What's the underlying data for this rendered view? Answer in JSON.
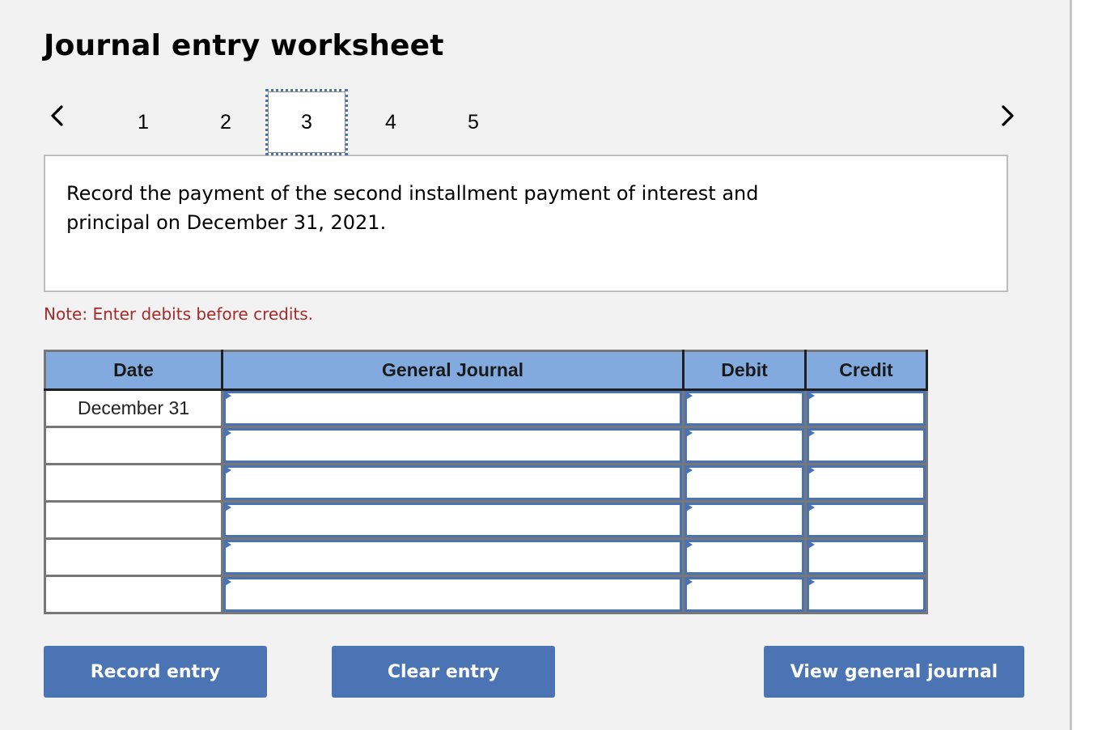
{
  "header": {
    "title": "Journal entry worksheet"
  },
  "pager": {
    "prev_icon": "chevron-left-icon",
    "next_icon": "chevron-right-icon",
    "tabs": [
      {
        "label": "1",
        "active": false
      },
      {
        "label": "2",
        "active": false
      },
      {
        "label": "3",
        "active": true
      },
      {
        "label": "4",
        "active": false
      },
      {
        "label": "5",
        "active": false
      }
    ]
  },
  "question": {
    "text": "Record the payment of the second installment payment of interest and principal on December 31, 2021."
  },
  "note": "Note: Enter debits before credits.",
  "journal": {
    "columns": [
      "Date",
      "General Journal",
      "Debit",
      "Credit"
    ],
    "rows": [
      {
        "date": "December 31",
        "account": "",
        "debit": "",
        "credit": ""
      },
      {
        "date": "",
        "account": "",
        "debit": "",
        "credit": ""
      },
      {
        "date": "",
        "account": "",
        "debit": "",
        "credit": ""
      },
      {
        "date": "",
        "account": "",
        "debit": "",
        "credit": ""
      },
      {
        "date": "",
        "account": "",
        "debit": "",
        "credit": ""
      },
      {
        "date": "",
        "account": "",
        "debit": "",
        "credit": ""
      }
    ]
  },
  "buttons": {
    "record": "Record entry",
    "clear": "Clear entry",
    "view": "View general journal"
  },
  "colors": {
    "accent": "#4a74b4",
    "header_fill": "#82aadf",
    "note": "#a52a2a"
  }
}
